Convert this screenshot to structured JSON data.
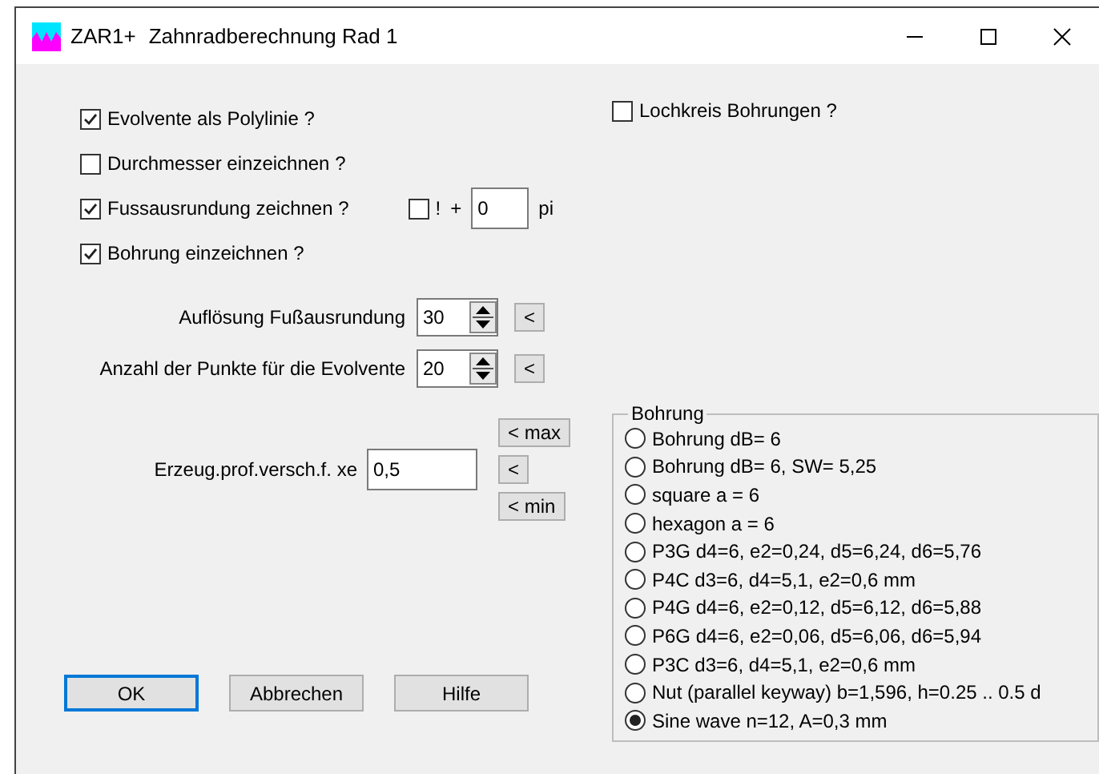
{
  "window": {
    "app_name": "ZAR1+",
    "title": "Zahnradberechnung Rad 1"
  },
  "options": [
    {
      "label": "Evolvente als Polylinie ?",
      "checked": true
    },
    {
      "label": "Durchmesser einzeichnen ?",
      "checked": false
    },
    {
      "label": "Fussausrundung zeichnen ?",
      "checked": true,
      "extra": {
        "label": "!",
        "checked": false,
        "plus": "+",
        "value": "0",
        "unit": "pi"
      }
    },
    {
      "label": "Bohrung einzeichnen ?",
      "checked": true
    }
  ],
  "lochkreis": {
    "label": "Lochkreis Bohrungen ?",
    "checked": false
  },
  "spinners": [
    {
      "label": "Auflösung Fußausrundung",
      "value": "30",
      "button": "<"
    },
    {
      "label": "Anzahl der Punkte für die Evolvente",
      "value": "20",
      "button": "<"
    }
  ],
  "xe": {
    "label": "Erzeug.prof.versch.f. xe",
    "value": "0,5",
    "buttons": [
      "< max",
      "<",
      "< min"
    ]
  },
  "bohrung": {
    "title": "Bohrung",
    "options": [
      {
        "label": "Bohrung dB= 6",
        "selected": false
      },
      {
        "label": "Bohrung dB= 6, SW= 5,25",
        "selected": false
      },
      {
        "label": "square a = 6",
        "selected": false
      },
      {
        "label": "hexagon a = 6",
        "selected": false
      },
      {
        "label": "P3G d4=6, e2=0,24, d5=6,24, d6=5,76",
        "selected": false
      },
      {
        "label": "P4C d3=6, d4=5,1, e2=0,6 mm",
        "selected": false
      },
      {
        "label": "P4G d4=6, e2=0,12, d5=6,12, d6=5,88",
        "selected": false
      },
      {
        "label": "P6G d4=6, e2=0,06, d5=6,06, d6=5,94",
        "selected": false
      },
      {
        "label": "P3C d3=6, d4=5,1, e2=0,6 mm",
        "selected": false
      },
      {
        "label": "Nut (parallel keyway) b=1,596, h=0.25 .. 0.5 d",
        "selected": false
      },
      {
        "label": "Sine wave n=12, A=0,3 mm",
        "selected": true
      }
    ]
  },
  "buttons": [
    {
      "label": "OK",
      "default": true
    },
    {
      "label": "Abbrechen",
      "default": false
    },
    {
      "label": "Hilfe",
      "default": false
    }
  ]
}
